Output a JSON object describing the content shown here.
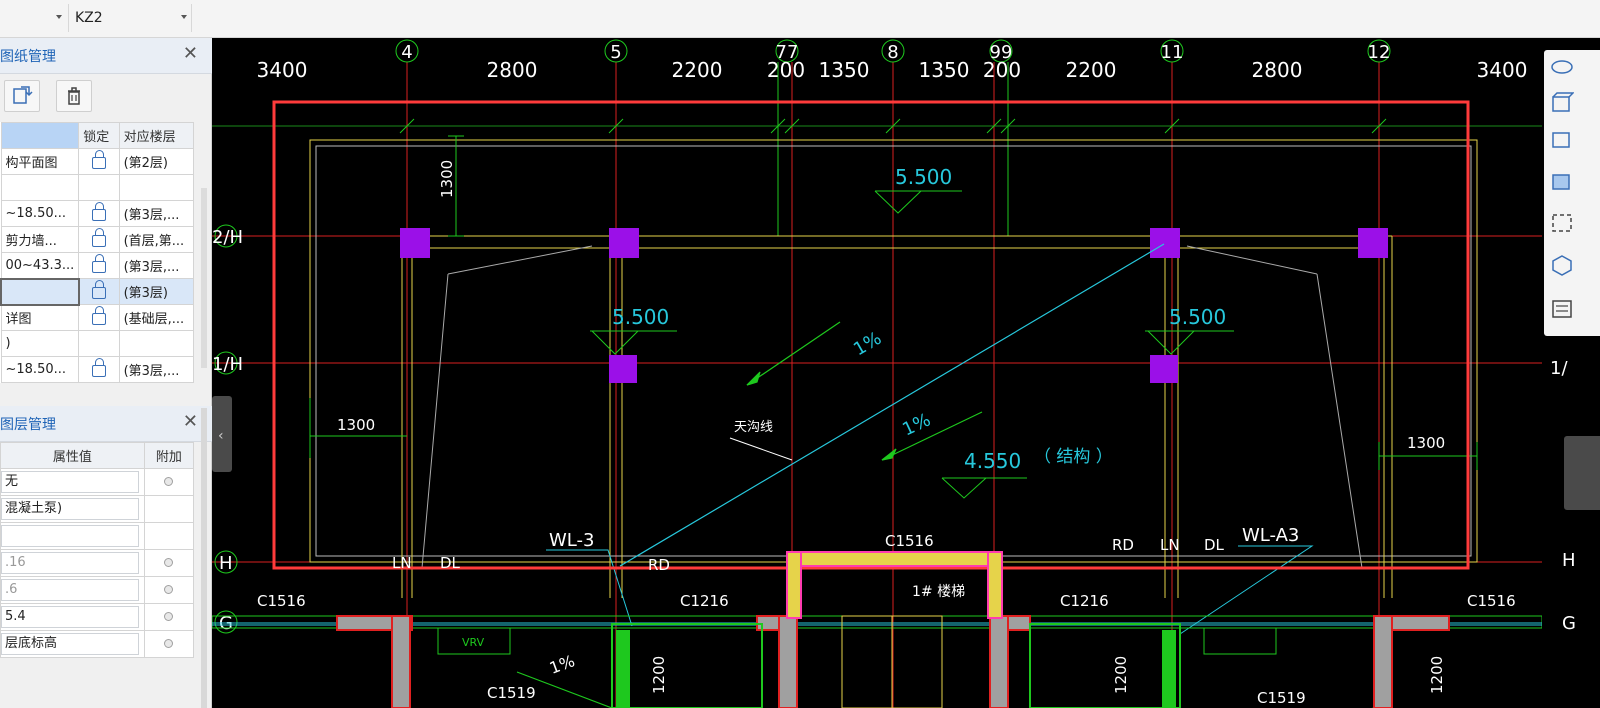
{
  "toolbar": {
    "select1_value": "",
    "select2_value": "KZ2"
  },
  "drawing_panel": {
    "title": "图纸管理",
    "columns": [
      "",
      "锁定",
      "对应楼层"
    ],
    "rows": [
      {
        "name": "构平面图",
        "floor": "(第2层)",
        "selected": false
      },
      {
        "name": "",
        "floor": "",
        "selected": false
      },
      {
        "name": "~18.50...",
        "floor": "(第3层,...",
        "selected": false
      },
      {
        "name": "剪力墙...",
        "floor": "(首层,第...",
        "selected": false
      },
      {
        "name": "00~43.3...",
        "floor": "(第3层,...",
        "selected": false
      },
      {
        "name": "",
        "floor": "(第3层)",
        "selected": true
      },
      {
        "name": "详图",
        "floor": "(基础层,...",
        "selected": false
      },
      {
        "name": ")",
        "floor": "",
        "selected": false
      },
      {
        "name": "~18.50...",
        "floor": "(第3层,...",
        "selected": false
      }
    ]
  },
  "layer_panel": {
    "title": "图层管理",
    "columns": [
      "属性值",
      "附加"
    ],
    "rows": [
      {
        "value": "无",
        "dot": true,
        "gray": false
      },
      {
        "value": "混凝土泵)",
        "dot": false,
        "gray": false
      },
      {
        "value": "",
        "dot": false,
        "gray": false
      },
      {
        "value": ".16",
        "dot": true,
        "gray": true
      },
      {
        "value": ".6",
        "dot": true,
        "gray": true
      },
      {
        "value": "5.4",
        "dot": true,
        "gray": false
      },
      {
        "value": "层底标高",
        "dot": true,
        "gray": false
      }
    ]
  },
  "cad": {
    "axis_labels": {
      "a4": "4",
      "a5": "5",
      "a77": "77",
      "a8": "8",
      "a99": "99",
      "a11": "11",
      "a12": "12",
      "r2h": "2/H",
      "r1h": "1/H",
      "rh": "H",
      "rg": "G",
      "r1h_right": "1/",
      "rh_right": "H",
      "rg_right": "G"
    },
    "dims_top": [
      "3400",
      "2800",
      "2200",
      "200",
      "1350",
      "1350",
      "200",
      "2200",
      "2800",
      "3400"
    ],
    "dim_1300_vertical": "1300",
    "dim_1300_left": "1300",
    "dim_1300_right": "1300",
    "elev_top": "5.500",
    "elev_left": "5.500",
    "elev_right": "5.500",
    "elev_mid": "4.550",
    "elev_mid_note": "（ 结构 ）",
    "slope_a": "1%",
    "slope_b": "1%",
    "slope_c": "1%",
    "gutter_label": "天沟线",
    "wl3": "WL-3",
    "wla3": "WL-A3",
    "c1516_center": "C1516",
    "c1516_left": "C1516",
    "c1516_right": "C1516",
    "c1216_left": "C1216",
    "c1216_right": "C1216",
    "c1519": "C1519",
    "c1519_right": "C1519",
    "stair": "1# 楼梯",
    "ln_l": "LN",
    "dl_l": "DL",
    "rd_l": "RD",
    "rd_r": "RD",
    "ln_r": "LN",
    "dl_r": "DL",
    "vrv": "VRV",
    "d1200a": "1200",
    "d1200b": "1200",
    "d1200c": "1200"
  },
  "colors": {
    "canvas_bg": "#000000",
    "axis_red": "#e02020",
    "column_purple": "#9b10e8",
    "slab_yellow": "#e6d34a",
    "cyan": "#27c8dc",
    "green": "#22d822",
    "selection_frame": "#ff3b3b"
  }
}
